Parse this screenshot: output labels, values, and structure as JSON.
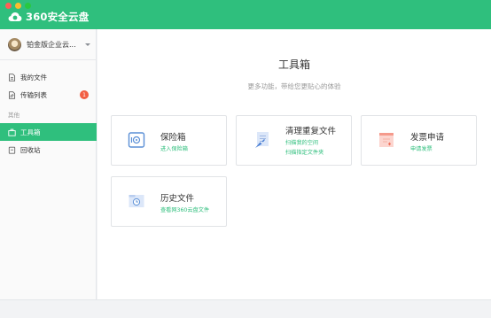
{
  "app": {
    "logo_text": "360安全云盘"
  },
  "account": {
    "name": "铂金版企业云..."
  },
  "sidebar": {
    "items": [
      {
        "label": "我的文件",
        "icon": "file-icon"
      },
      {
        "label": "传输列表",
        "icon": "transfer-icon",
        "badge": "1"
      },
      {
        "label": "工具箱",
        "icon": "toolbox-icon",
        "active": true
      },
      {
        "label": "回收站",
        "icon": "trash-icon"
      }
    ],
    "group_label": "其他"
  },
  "main": {
    "title": "工具箱",
    "subtitle": "更多功能，带给您更贴心的体验",
    "cards": [
      {
        "title": "保险箱",
        "lines": [
          "进入保险箱"
        ],
        "icon": "safe-icon"
      },
      {
        "title": "清理重复文件",
        "lines": [
          "扫描我的空间",
          "扫描指定文件夹"
        ],
        "icon": "clean-duplicates-icon"
      },
      {
        "title": "发票申请",
        "lines": [
          "申请发票"
        ],
        "icon": "invoice-icon"
      },
      {
        "title": "历史文件",
        "lines": [
          "查看网360云盘文件"
        ],
        "icon": "history-file-icon"
      }
    ]
  },
  "colors": {
    "brand": "#2fbf7d",
    "badge": "#f25e43"
  }
}
